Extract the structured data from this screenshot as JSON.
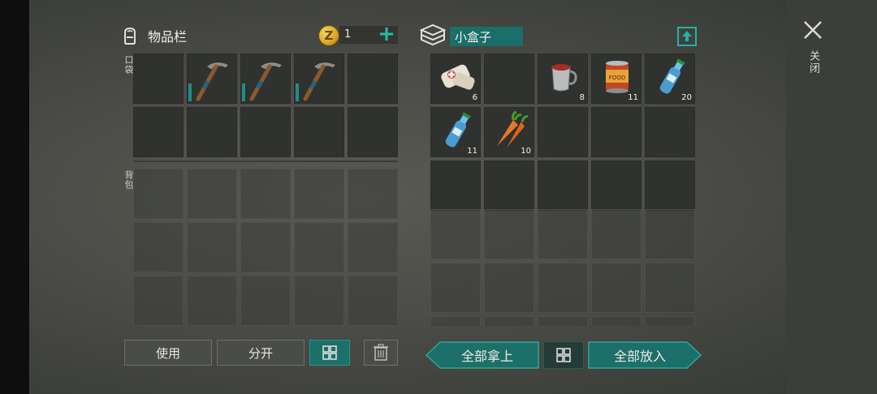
{
  "inventory": {
    "title": "物品栏",
    "pocket_label": "口袋",
    "backpack_label": "背包",
    "coins": "1",
    "pocket_slots": [
      {
        "item": "",
        "count": ""
      },
      {
        "item": "pickaxe-icon",
        "count": ""
      },
      {
        "item": "pickaxe-icon",
        "count": ""
      },
      {
        "item": "pickaxe-icon",
        "count": ""
      },
      {
        "item": "",
        "count": ""
      },
      {
        "item": "",
        "count": ""
      },
      {
        "item": "",
        "count": ""
      },
      {
        "item": "",
        "count": ""
      },
      {
        "item": "",
        "count": ""
      },
      {
        "item": "",
        "count": ""
      }
    ]
  },
  "container": {
    "title": "小盒子",
    "slots": [
      {
        "item": "bandage-icon",
        "count": "6"
      },
      {
        "item": "",
        "count": ""
      },
      {
        "item": "mug-icon",
        "count": "8"
      },
      {
        "item": "canned-food-icon",
        "count": "11"
      },
      {
        "item": "water-bottle-icon",
        "count": "20"
      },
      {
        "item": "water-bottle-icon",
        "count": "11"
      },
      {
        "item": "carrot-icon",
        "count": "10"
      }
    ]
  },
  "buttons": {
    "use": "使用",
    "split": "分开",
    "take_all": "全部拿上",
    "put_all": "全部放入"
  },
  "close_label": "关闭",
  "colors": {
    "accent": "#1d6f69",
    "accent_bright": "#23b3a0",
    "durability": "#1f8e86"
  }
}
